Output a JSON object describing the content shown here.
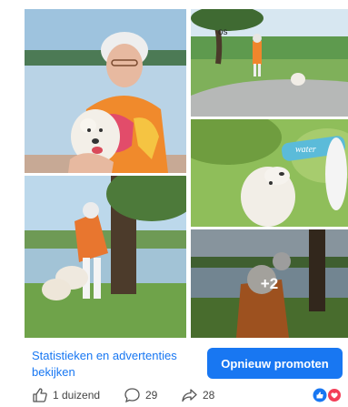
{
  "photos": {
    "caption_tr": "os",
    "more_count": "+2"
  },
  "footer": {
    "stats_link": "Statistieken en advertenties bekijken",
    "promote_button": "Opnieuw promoten"
  },
  "engagement": {
    "likes": "1 duizend",
    "comments": "29",
    "shares": "28"
  },
  "reaction_icons": [
    "like-reaction-icon",
    "love-reaction-icon"
  ],
  "colors": {
    "accent": "#1877f2",
    "love": "#f33e58"
  }
}
